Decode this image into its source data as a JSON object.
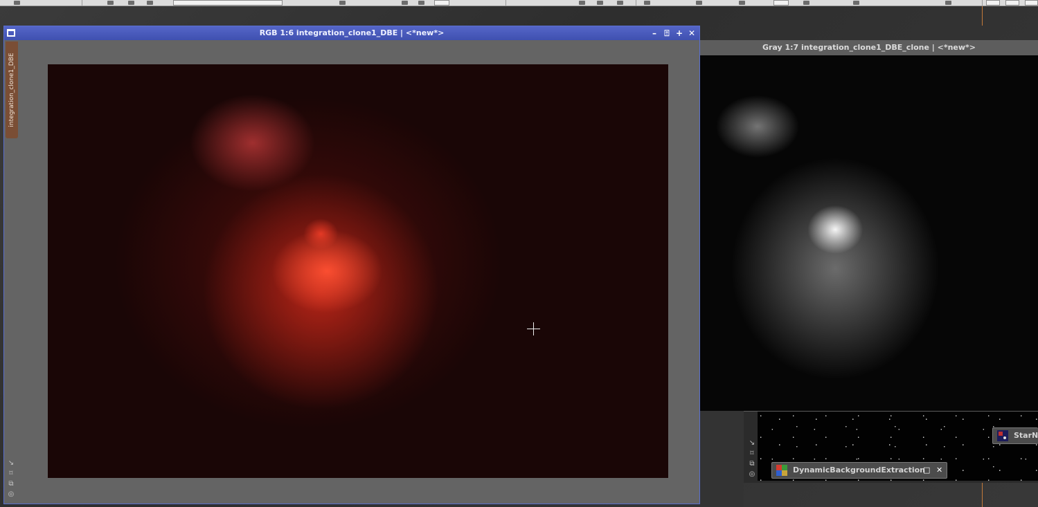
{
  "windows": {
    "rgb": {
      "title": "RGB 1:6 integration_clone1_DBE | <*new*>",
      "tab_label": "integration_clone1_DBE",
      "controls": {
        "minimize": "–",
        "shade": "⍐",
        "maximize": "+",
        "close": "✕"
      }
    },
    "gray": {
      "title": "Gray 1:7 integration_clone1_DBE_clone | <*new*>"
    }
  },
  "process_icons": {
    "dbe": {
      "label": "DynamicBackgroundExtraction",
      "restore": "□",
      "close": "✕"
    },
    "starnet": {
      "label": "StarNe"
    }
  },
  "side_tools": [
    "↘",
    "⌑",
    "⧉",
    "◎"
  ],
  "colors": {
    "title_active": "#4b5cbf",
    "title_inactive": "#5d5d5d",
    "tab_bg": "#7a4e35",
    "workspace": "#333333"
  }
}
